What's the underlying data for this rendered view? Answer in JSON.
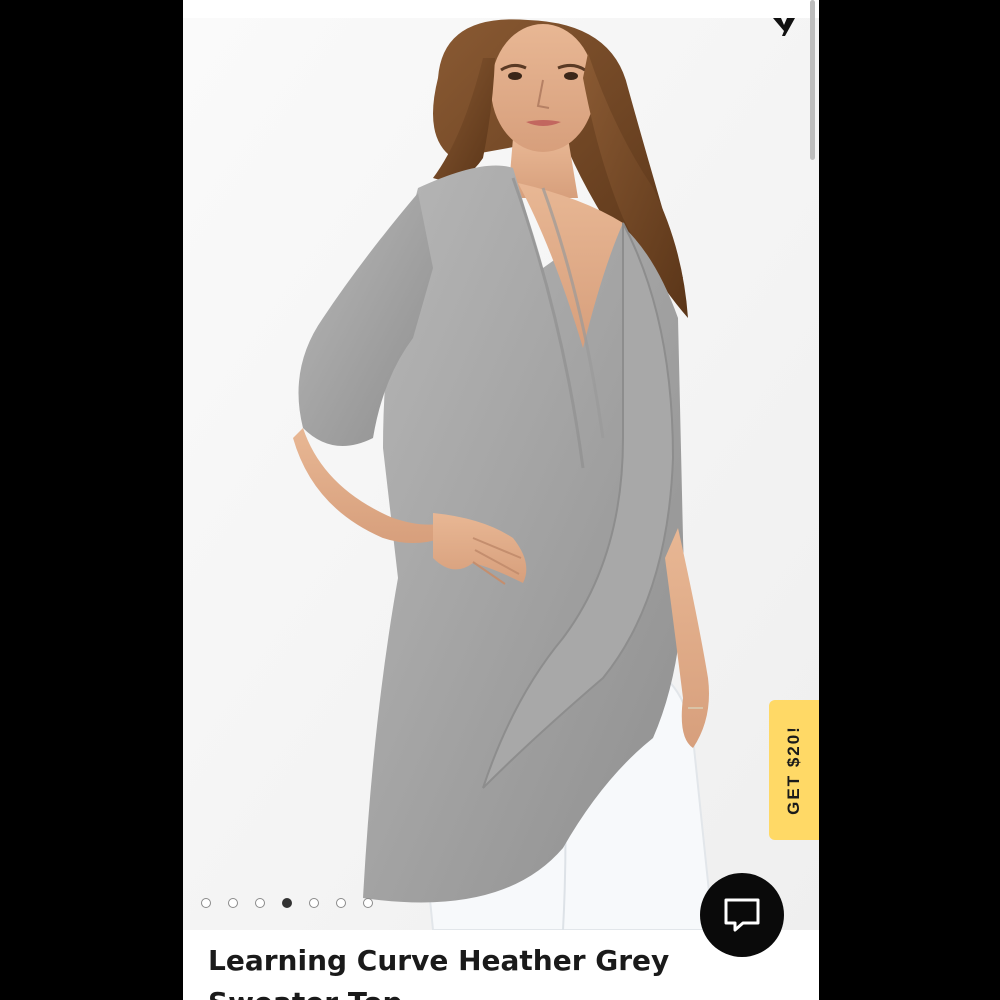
{
  "product": {
    "title": "Learning Curve Heather Grey Sweater Top"
  },
  "carousel": {
    "total_slides": 7,
    "active_index": 3
  },
  "promo_tab": {
    "label": "GET $20!",
    "color": "#ffd966"
  },
  "chat": {
    "icon": "chat-bubble-icon"
  },
  "brand": {
    "icon": "brand-logo-icon"
  }
}
